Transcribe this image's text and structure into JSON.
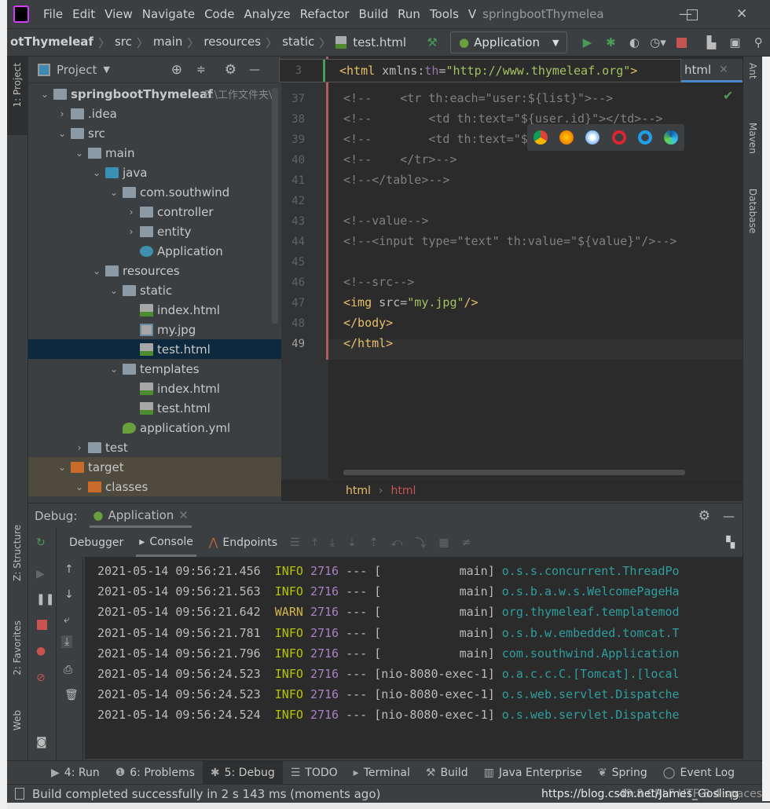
{
  "menubar": {
    "items": [
      "File",
      "Edit",
      "View",
      "Navigate",
      "Code",
      "Analyze",
      "Refactor",
      "Build",
      "Run",
      "Tools",
      "V"
    ],
    "title": "springbootThymelea"
  },
  "navbar": {
    "crumbs": [
      "otThymeleaf",
      "src",
      "main",
      "resources",
      "static"
    ],
    "file": "test.html",
    "run_config": "Application"
  },
  "left_stripe": {
    "project": "1: Project",
    "structure": "Z: Structure",
    "favorites": "2: Favorites",
    "web": "Web"
  },
  "right_stripe": {
    "ant": "Ant",
    "maven": "Maven",
    "database": "Database"
  },
  "project": {
    "title": "Project",
    "tree": [
      {
        "label": "springbootThymeleaf",
        "extra": "E:\\工作文件夹\\",
        "depth": 0,
        "arrow": "down",
        "icon": "module-folder"
      },
      {
        "label": ".idea",
        "depth": 1,
        "arrow": "right",
        "icon": "folder"
      },
      {
        "label": "src",
        "depth": 1,
        "arrow": "down",
        "icon": "folder"
      },
      {
        "label": "main",
        "depth": 2,
        "arrow": "down",
        "icon": "folder"
      },
      {
        "label": "java",
        "depth": 3,
        "arrow": "down",
        "icon": "source-folder"
      },
      {
        "label": "com.southwind",
        "depth": 4,
        "arrow": "down",
        "icon": "package"
      },
      {
        "label": "controller",
        "depth": 5,
        "arrow": "right",
        "icon": "package"
      },
      {
        "label": "entity",
        "depth": 5,
        "arrow": "right",
        "icon": "package"
      },
      {
        "label": "Application",
        "depth": 5,
        "arrow": "",
        "icon": "spring-boot-class"
      },
      {
        "label": "resources",
        "depth": 3,
        "arrow": "down",
        "icon": "resources-folder"
      },
      {
        "label": "static",
        "depth": 4,
        "arrow": "down",
        "icon": "folder"
      },
      {
        "label": "index.html",
        "depth": 5,
        "arrow": "",
        "icon": "html-file"
      },
      {
        "label": "my.jpg",
        "depth": 5,
        "arrow": "",
        "icon": "image-file"
      },
      {
        "label": "test.html",
        "depth": 5,
        "arrow": "",
        "icon": "html-file",
        "selected": true
      },
      {
        "label": "templates",
        "depth": 4,
        "arrow": "down",
        "icon": "folder"
      },
      {
        "label": "index.html",
        "depth": 5,
        "arrow": "",
        "icon": "html-file"
      },
      {
        "label": "test.html",
        "depth": 5,
        "arrow": "",
        "icon": "html-file"
      },
      {
        "label": "application.yml",
        "depth": 4,
        "arrow": "",
        "icon": "spring-config"
      },
      {
        "label": "test",
        "depth": 2,
        "arrow": "right",
        "icon": "folder"
      },
      {
        "label": "target",
        "depth": 1,
        "arrow": "down",
        "icon": "excluded-folder",
        "excluded": true
      },
      {
        "label": "classes",
        "depth": 2,
        "arrow": "down",
        "icon": "excluded-folder",
        "excluded": true
      }
    ]
  },
  "editor": {
    "tab_label": "html",
    "sticky": {
      "line": "3",
      "segments": [
        {
          "t": "<html",
          "c": "tag"
        },
        {
          "t": " xmlns:",
          "c": "attr"
        },
        {
          "t": "th",
          "c": "ns"
        },
        {
          "t": "=",
          "c": "attr"
        },
        {
          "t": "\"http://www.thymeleaf.org\"",
          "c": "str"
        },
        {
          "t": ">",
          "c": "tag"
        }
      ]
    },
    "lines": [
      {
        "n": "37",
        "segments": [
          {
            "t": "<!--    <tr th:each=\"user:${list}\">-->",
            "c": "comment"
          }
        ]
      },
      {
        "n": "38",
        "segments": [
          {
            "t": "<!--        <td th:text=\"${user.id}\"></td>-->",
            "c": "comment"
          }
        ]
      },
      {
        "n": "39",
        "segments": [
          {
            "t": "<!--        <td th:text=\"${user.name}\"></td>-->",
            "c": "comment"
          }
        ]
      },
      {
        "n": "40",
        "segments": [
          {
            "t": "<!--    </tr>-->",
            "c": "comment"
          }
        ]
      },
      {
        "n": "41",
        "segments": [
          {
            "t": "<!--</table>-->",
            "c": "comment"
          }
        ]
      },
      {
        "n": "42",
        "segments": []
      },
      {
        "n": "43",
        "segments": [
          {
            "t": "<!--value-->",
            "c": "comment"
          }
        ]
      },
      {
        "n": "44",
        "segments": [
          {
            "t": "<!--<input type=\"text\" th:value=\"${value}\"/>-->",
            "c": "comment"
          }
        ]
      },
      {
        "n": "45",
        "segments": []
      },
      {
        "n": "46",
        "segments": [
          {
            "t": "<!--src-->",
            "c": "comment"
          }
        ]
      },
      {
        "n": "47",
        "segments": [
          {
            "t": "<img",
            "c": "tag"
          },
          {
            "t": " src=",
            "c": "attr"
          },
          {
            "t": "\"my.jpg\"",
            "c": "str"
          },
          {
            "t": "/>",
            "c": "tag"
          }
        ]
      },
      {
        "n": "48",
        "segments": [
          {
            "t": "</body>",
            "c": "tag"
          }
        ]
      },
      {
        "n": "49",
        "segments": [
          {
            "t": "</html>",
            "c": "tag"
          }
        ]
      }
    ],
    "breadcrumb": [
      "html",
      "html"
    ],
    "browsers": [
      "chrome",
      "firefox",
      "safari",
      "opera",
      "internet-explorer",
      "edge"
    ]
  },
  "debug": {
    "label": "Debug:",
    "session": "Application",
    "tabs": [
      "Debugger",
      "Console",
      "Endpoints"
    ],
    "log": [
      {
        "ts": "2021-05-14 09:56:21.456",
        "level": "INFO",
        "pid": "2716",
        "sep": "---",
        "thread": "[           main]",
        "logger": "o.s.s.concurrent.ThreadPo"
      },
      {
        "ts": "2021-05-14 09:56:21.563",
        "level": "INFO",
        "pid": "2716",
        "sep": "---",
        "thread": "[           main]",
        "logger": "o.s.b.a.w.s.WelcomePageHa"
      },
      {
        "ts": "2021-05-14 09:56:21.642",
        "level": "WARN",
        "pid": "2716",
        "sep": "---",
        "thread": "[           main]",
        "logger": "org.thymeleaf.templatemod"
      },
      {
        "ts": "2021-05-14 09:56:21.781",
        "level": "INFO",
        "pid": "2716",
        "sep": "---",
        "thread": "[           main]",
        "logger": "o.s.b.w.embedded.tomcat.T"
      },
      {
        "ts": "2021-05-14 09:56:21.796",
        "level": "INFO",
        "pid": "2716",
        "sep": "---",
        "thread": "[           main]",
        "logger": "com.southwind.Application"
      },
      {
        "ts": "2021-05-14 09:56:24.523",
        "level": "INFO",
        "pid": "2716",
        "sep": "---",
        "thread": "[nio-8080-exec-1]",
        "logger": "o.a.c.c.C.[Tomcat].[local"
      },
      {
        "ts": "2021-05-14 09:56:24.523",
        "level": "INFO",
        "pid": "2716",
        "sep": "---",
        "thread": "[nio-8080-exec-1]",
        "logger": "o.s.web.servlet.Dispatche"
      },
      {
        "ts": "2021-05-14 09:56:24.524",
        "level": "INFO",
        "pid": "2716",
        "sep": "---",
        "thread": "[nio-8080-exec-1]",
        "logger": "o.s.web.servlet.Dispatche"
      }
    ]
  },
  "toolwindows": [
    {
      "label": "4: Run",
      "icon": "run-icon"
    },
    {
      "label": "6: Problems",
      "icon": "problems-icon"
    },
    {
      "label": "5: Debug",
      "icon": "debug-icon",
      "active": true
    },
    {
      "label": "TODO",
      "icon": "todo-icon"
    },
    {
      "label": "Terminal",
      "icon": "terminal-icon"
    },
    {
      "label": "Build",
      "icon": "build-icon"
    },
    {
      "label": "Java Enterprise",
      "icon": "java-enterprise-icon"
    },
    {
      "label": "Spring",
      "icon": "spring-icon"
    },
    {
      "label": "Event Log",
      "icon": "event-log-icon"
    }
  ],
  "status": {
    "message": "Build completed successfully in 2 s 143 ms (moments ago)",
    "right": "49:8  CRLF  UTF-8  4 spaces",
    "watermark": "https://blog.csdn.net/James_Gosling"
  },
  "colors": {
    "accent": "#4a88c7",
    "selection": "#0d293e",
    "run_green": "#499c54",
    "stop_red": "#c75450"
  }
}
